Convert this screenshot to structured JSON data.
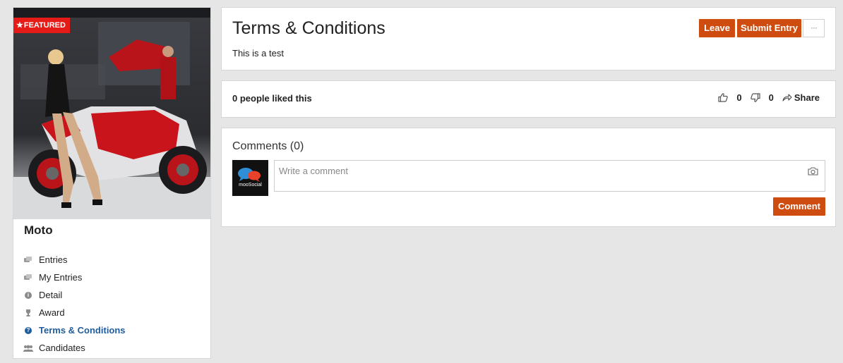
{
  "sidebar": {
    "badge": "FEATURED",
    "contest_title": "Moto",
    "menu": [
      {
        "label": "Entries",
        "icon": "entries-icon"
      },
      {
        "label": "My Entries",
        "icon": "my-entries-icon"
      },
      {
        "label": "Detail",
        "icon": "info-icon"
      },
      {
        "label": "Award",
        "icon": "trophy-icon"
      },
      {
        "label": "Terms & Conditions",
        "icon": "question-icon",
        "active": true
      },
      {
        "label": "Candidates",
        "icon": "users-icon"
      }
    ]
  },
  "header": {
    "title": "Terms & Conditions",
    "description": "This is a test",
    "leave_label": "Leave",
    "submit_label": "Submit Entry",
    "more_label": "···"
  },
  "likes": {
    "summary": "0 people liked this",
    "like_count": "0",
    "dislike_count": "0",
    "share_label": "Share"
  },
  "comments": {
    "title": "Comments (0)",
    "placeholder": "Write a comment",
    "avatar_text": "mooSocial",
    "submit_label": "Comment"
  },
  "colors": {
    "accent": "#cf4c10",
    "badge": "#e41b17",
    "active_link": "#1f5c9e",
    "background": "#e6e6e7"
  }
}
